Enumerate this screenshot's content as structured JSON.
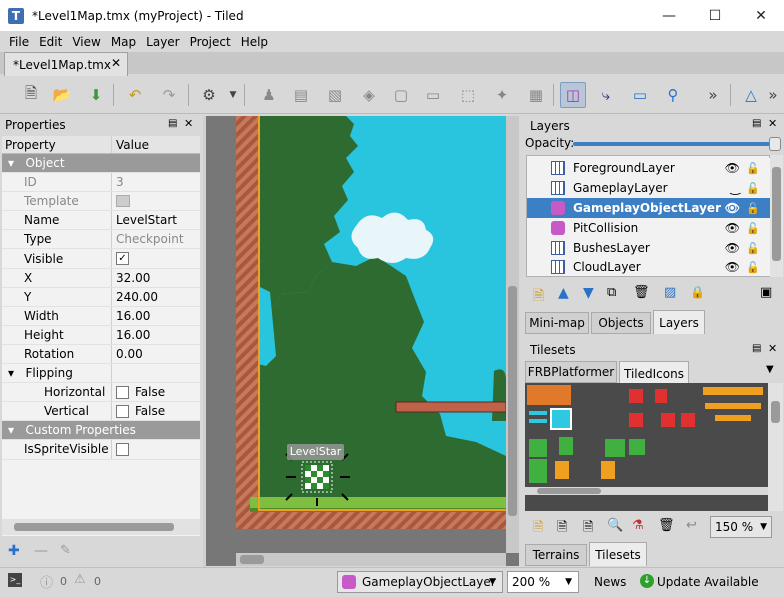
{
  "window": {
    "title": "*Level1Map.tmx (myProject) - Tiled",
    "app_icon": "T"
  },
  "menu": [
    "File",
    "Edit",
    "View",
    "Map",
    "Layer",
    "Project",
    "Help"
  ],
  "document_tab": "*Level1Map.tmx",
  "properties": {
    "title": "Properties",
    "col_property": "Property",
    "col_value": "Value",
    "group_object": "Object",
    "rows": [
      {
        "k": "ID",
        "v": "3",
        "dis": true
      },
      {
        "k": "Template",
        "v": "",
        "dis": true
      },
      {
        "k": "Name",
        "v": "LevelStart"
      },
      {
        "k": "Type",
        "v": "Checkpoint",
        "dis_v": true
      },
      {
        "k": "Visible",
        "v": "✓",
        "check": true
      },
      {
        "k": "X",
        "v": "32.00"
      },
      {
        "k": "Y",
        "v": "240.00"
      },
      {
        "k": "Width",
        "v": "16.00"
      },
      {
        "k": "Height",
        "v": "16.00"
      },
      {
        "k": "Rotation",
        "v": "0.00"
      }
    ],
    "group_flipping": "Flipping",
    "flip_rows": [
      {
        "k": "Horizontal",
        "v": "False"
      },
      {
        "k": "Vertical",
        "v": "False"
      }
    ],
    "group_custom": "Custom Properties",
    "custom_rows": [
      {
        "k": "IsSpriteVisible",
        "v": ""
      }
    ]
  },
  "canvas": {
    "object_label": "LevelStar"
  },
  "layers": {
    "title": "Layers",
    "opacity_label": "Opacity:",
    "items": [
      {
        "name": "ForegroundLayer",
        "kind": "tile"
      },
      {
        "name": "GameplayLayer",
        "kind": "tile",
        "hidden": true
      },
      {
        "name": "GameplayObjectLayer",
        "kind": "object",
        "selected": true
      },
      {
        "name": "PitCollision",
        "kind": "object"
      },
      {
        "name": "BushesLayer",
        "kind": "tile"
      },
      {
        "name": "CloudLayer",
        "kind": "tile"
      }
    ],
    "tabs": [
      "Mini-map",
      "Objects",
      "Layers"
    ]
  },
  "tilesets": {
    "title": "Tilesets",
    "tabs": [
      "FRBPlatformer",
      "TiledIcons"
    ],
    "zoom": "150 %",
    "bottom_tabs": [
      "Terrains",
      "Tilesets"
    ]
  },
  "status": {
    "errors": "0",
    "warnings": "0",
    "layer_combo": "GameplayObjectLayer",
    "zoom_combo": "200 %",
    "news": "News",
    "update": "Update Available"
  },
  "colors": {
    "accent": "#3d7fc4",
    "sky": "#2ec8e0",
    "foliage": "#2e6b30",
    "object_layer": "#c85ac8"
  }
}
